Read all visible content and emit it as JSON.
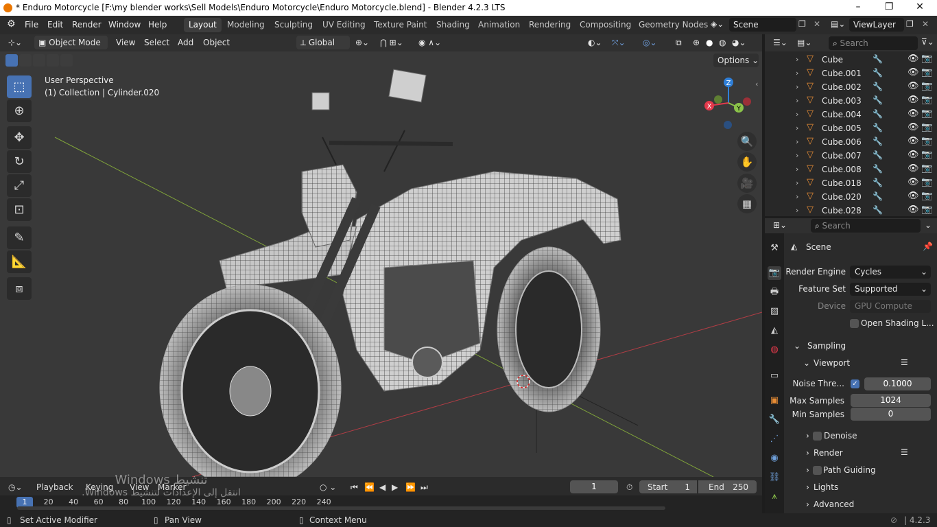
{
  "window": {
    "title": "* Enduro Motorcycle [F:\\my blender works\\Sell Models\\Enduro Motorcycle\\Enduro Motorcycle.blend] - Blender 4.2.3 LTS",
    "minimize": "–",
    "maximize": "❐",
    "close": "✕"
  },
  "menubar": [
    "File",
    "Edit",
    "Render",
    "Window",
    "Help"
  ],
  "workspaces": [
    "Layout",
    "Modeling",
    "Sculpting",
    "UV Editing",
    "Texture Paint",
    "Shading",
    "Animation",
    "Rendering",
    "Compositing",
    "Geometry Nodes"
  ],
  "active_workspace": "Layout",
  "scene_name": "Scene",
  "view_layer": "ViewLayer",
  "viewport": {
    "mode": "Object Mode",
    "menus": [
      "View",
      "Select",
      "Add",
      "Object"
    ],
    "orientation": "Global",
    "options_label": "Options",
    "perspective_label": "User Perspective",
    "collection_label": "(1) Collection | Cylinder.020",
    "gizmo_axes": {
      "x": "X",
      "y": "Y",
      "z": "Z"
    }
  },
  "outliner": {
    "search_placeholder": "Search",
    "items": [
      "Cube",
      "Cube.001",
      "Cube.002",
      "Cube.003",
      "Cube.004",
      "Cube.005",
      "Cube.006",
      "Cube.007",
      "Cube.008",
      "Cube.018",
      "Cube.020",
      "Cube.028"
    ]
  },
  "properties": {
    "search_placeholder": "Search",
    "context": "Scene",
    "render_engine_label": "Render Engine",
    "render_engine": "Cycles",
    "feature_set_label": "Feature Set",
    "feature_set": "Supported",
    "device_label": "Device",
    "device": "GPU Compute",
    "open_shading_label": "Open Shading L...",
    "sampling_label": "Sampling",
    "viewport_label": "Viewport",
    "noise_threshold_label": "Noise Thre...",
    "noise_threshold": "0.1000",
    "max_samples_label": "Max Samples",
    "max_samples": "1024",
    "min_samples_label": "Min Samples",
    "min_samples": "0",
    "denoise_label": "Denoise",
    "render_label": "Render",
    "path_guiding_label": "Path Guiding",
    "lights_label": "Lights",
    "advanced_label": "Advanced"
  },
  "timeline": {
    "menus": [
      "Playback",
      "Keying",
      "View",
      "Marker"
    ],
    "current_frame": "1",
    "start_label": "Start",
    "start": "1",
    "end_label": "End",
    "end": "250",
    "ruler": [
      "1",
      "20",
      "40",
      "60",
      "80",
      "100",
      "120",
      "140",
      "160",
      "180",
      "200",
      "220",
      "240"
    ]
  },
  "statusbar": {
    "left": "Set Active Modifier",
    "middle": "Pan View",
    "right": "Context Menu",
    "version": "4.2.3"
  },
  "watermark": {
    "line1": "تنشيط Windows",
    "line2": "انتقل إلى الإعدادات لتنشيط Windows."
  },
  "colors": {
    "accent": "#4772b3",
    "object_orange": "#e88d35",
    "axis_x": "#e3394b",
    "axis_y": "#8bc34a",
    "axis_z": "#2f7fd8"
  }
}
